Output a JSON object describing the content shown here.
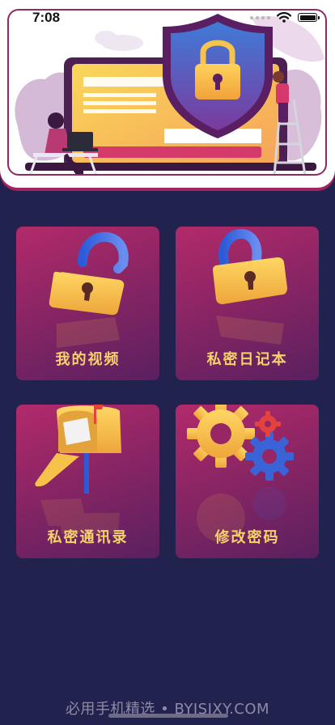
{
  "status_bar": {
    "time": "7:08"
  },
  "menu": [
    {
      "label": "我的视频",
      "icon": "open-padlock-icon"
    },
    {
      "label": "私密日记本",
      "icon": "open-padlock-icon"
    },
    {
      "label": "私密通讯录",
      "icon": "mailbox-icon"
    },
    {
      "label": "修改密码",
      "icon": "gears-icon"
    }
  ],
  "footer": {
    "watermark": "必用手机精选 • BYJSJXY.COM"
  },
  "colors": {
    "background": "#22224f",
    "tile_gradient_top": "#b22a6b",
    "tile_label": "#f7d26a",
    "accent": "#8e2a66"
  }
}
